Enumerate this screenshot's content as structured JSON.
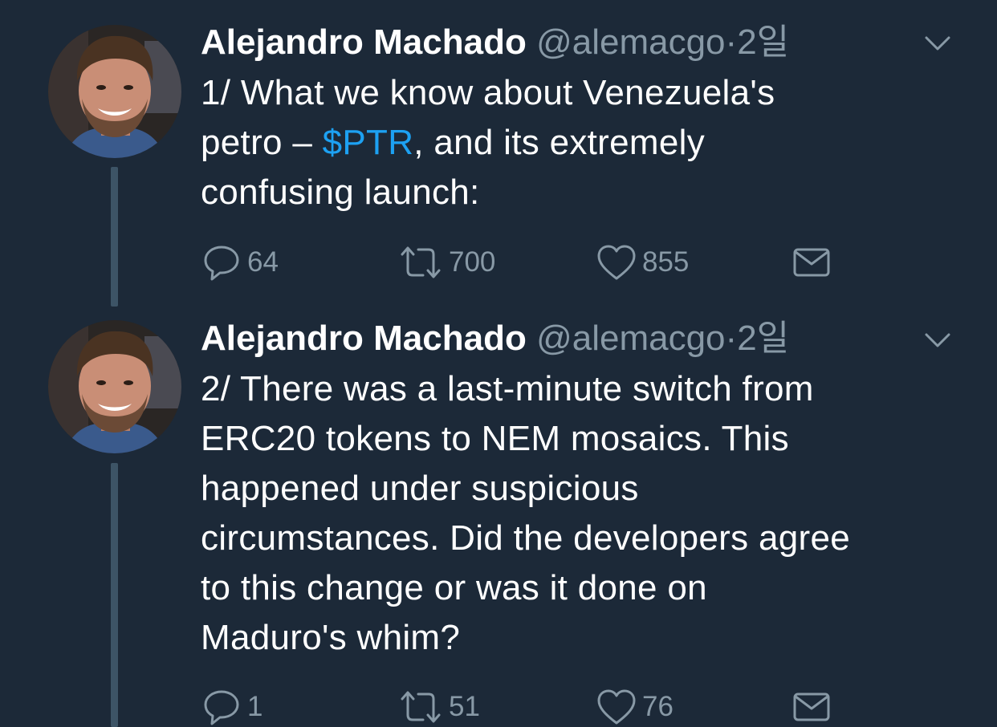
{
  "colors": {
    "background": "#1c2938",
    "text": "#ffffff",
    "secondary": "#8899a6",
    "link": "#1da1f2",
    "thread_line": "#3d5466"
  },
  "tweets": [
    {
      "name": "Alejandro Machado",
      "handle": "@alemacgo",
      "separator": "·",
      "time": "2일",
      "text_parts": {
        "l1": "1/ What we know about Venezuela's",
        "l2_before": "petro – ",
        "l2_cashtag": "$PTR",
        "l2_after": ", and its extremely",
        "l3": "confusing launch:"
      },
      "replies": "64",
      "retweets": "700",
      "likes": "855",
      "icons": [
        "chevron-down-icon",
        "reply-icon",
        "retweet-icon",
        "heart-icon",
        "mail-icon"
      ]
    },
    {
      "name": "Alejandro Machado",
      "handle": "@alemacgo",
      "separator": "·",
      "time": "2일",
      "text_lines": [
        "2/ There was a last-minute switch from",
        "ERC20 tokens to NEM mosaics. This",
        "happened under suspicious",
        "circumstances. Did the developers agree",
        "to this change or was it done on",
        "Maduro's whim?"
      ],
      "replies": "1",
      "retweets": "51",
      "likes": "76",
      "icons": [
        "chevron-down-icon",
        "reply-icon",
        "retweet-icon",
        "heart-icon",
        "mail-icon"
      ]
    }
  ]
}
